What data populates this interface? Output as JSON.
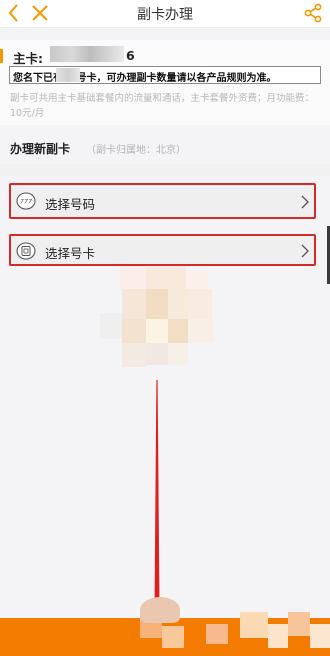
{
  "header": {
    "title": "副卡办理"
  },
  "main_card": {
    "label": "主卡:",
    "number_suffix": "6",
    "notice": "您名下已有    张号卡，可办理副卡数量请以各产品规则为准。",
    "description": "副卡可共用主卡基础套餐内的流量和通话，主卡套餐外资费；月功能费：10元/月"
  },
  "new_card_section": {
    "title": "办理新副卡",
    "subtitle": "（副卡归属地：北京）"
  },
  "options": [
    {
      "label": "选择号码",
      "icon": "number-badge-icon"
    },
    {
      "label": "选择号卡",
      "icon": "sim-card-icon"
    }
  ],
  "colors": {
    "accent_orange": "#f39800",
    "highlight_red": "#d42a2a",
    "bottom_bar": "#f37c00"
  }
}
